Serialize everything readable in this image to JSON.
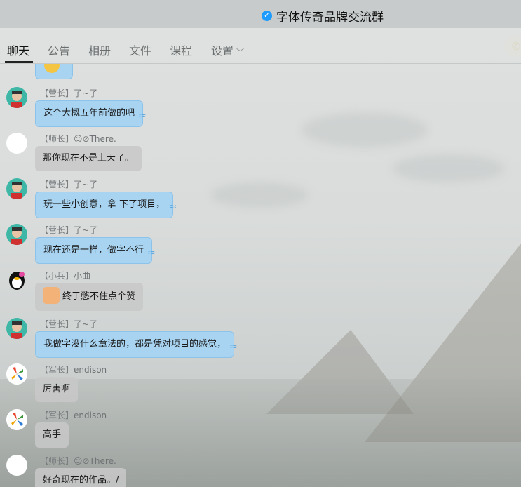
{
  "window": {
    "title": "字体传奇品牌交流群"
  },
  "tabs": [
    {
      "label": "聊天",
      "active": true
    },
    {
      "label": "公告"
    },
    {
      "label": "相册"
    },
    {
      "label": "文件"
    },
    {
      "label": "课程"
    },
    {
      "label": "设置"
    }
  ],
  "messages": [
    {
      "rank": "【营长】",
      "sender": "了~了",
      "text": "这个大概五年前做的吧",
      "avatar": "teal"
    },
    {
      "rank": "【师长】",
      "sender": "☺⊘There.",
      "text": "那你现在不是上天了。",
      "avatar": "white"
    },
    {
      "rank": "【营长】",
      "sender": "了~了",
      "text": "玩一些小创意，拿 下了项目，",
      "avatar": "teal"
    },
    {
      "rank": "【营长】",
      "sender": "了~了",
      "text": "现在还是一样，做字不行",
      "avatar": "teal"
    },
    {
      "rank": "【小兵】",
      "sender": "小曲",
      "text": "终于憋不住点个赞",
      "avatar": "penguin"
    },
    {
      "rank": "【营长】",
      "sender": "了~了",
      "text": "我做字没什么章法的，都是凭对项目的感觉，",
      "avatar": "teal"
    },
    {
      "rank": "【军长】",
      "sender": "endison",
      "text": "厉害啊",
      "avatar": "flower"
    },
    {
      "rank": "【军长】",
      "sender": "endison",
      "text": "高手",
      "avatar": "flower"
    },
    {
      "rank": "【师长】",
      "sender": "☺⊘There.",
      "text": "好奇现在的作品。/",
      "avatar": "white"
    }
  ],
  "colors": {
    "bubble_blue": "#a8d4f2",
    "bubble_gray": "#c8c8c8",
    "verified": "#1e9bff",
    "call": "#c9a400"
  }
}
